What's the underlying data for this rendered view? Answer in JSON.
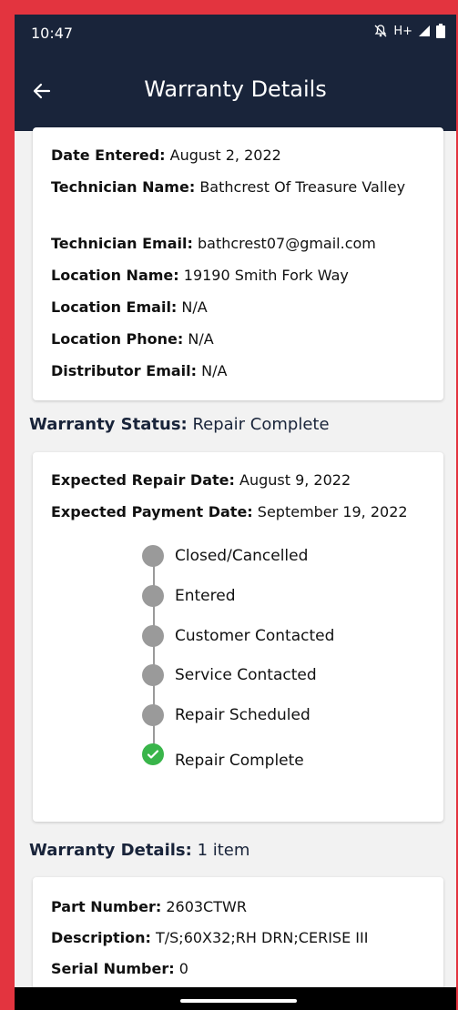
{
  "status_bar": {
    "time": "10:47",
    "network": "H+"
  },
  "app_bar": {
    "title": "Warranty Details"
  },
  "details_card": {
    "date_entered": {
      "label": "Date Entered:",
      "value": " August 2, 2022"
    },
    "technician_name": {
      "label": "Technician Name:",
      "value": " Bathcrest Of Treasure Valley"
    },
    "technician_email": {
      "label": "Technician Email:",
      "value": " bathcrest07@gmail.com"
    },
    "location_name": {
      "label": "Location Name:",
      "value": " 19190 Smith Fork Way"
    },
    "location_email": {
      "label": "Location Email:",
      "value": " N/A"
    },
    "location_phone": {
      "label": "Location Phone:",
      "value": " N/A"
    },
    "distributor_email": {
      "label": "Distributor Email:",
      "value": " N/A"
    }
  },
  "warranty_status": {
    "label": "Warranty Status:",
    "value": " Repair Complete"
  },
  "status_card": {
    "expected_repair": {
      "label": "Expected Repair Date:",
      "value": " August 9, 2022"
    },
    "expected_payment": {
      "label": "Expected Payment Date:",
      "value": " September 19, 2022"
    },
    "timeline": [
      {
        "label": "Closed/Cancelled",
        "done": false
      },
      {
        "label": "Entered",
        "done": false
      },
      {
        "label": "Customer Contacted",
        "done": false
      },
      {
        "label": "Service Contacted",
        "done": false
      },
      {
        "label": "Repair Scheduled",
        "done": false
      },
      {
        "label": "Repair Complete",
        "done": true
      }
    ]
  },
  "warranty_details": {
    "label": "Warranty Details:",
    "value": " 1 item"
  },
  "item_card": {
    "part_number": {
      "label": "Part Number:",
      "value": " 2603CTWR"
    },
    "description": {
      "label": "Description:",
      "value": " T/S;60X32;RH DRN;CERISE III"
    },
    "serial_number": {
      "label": "Serial Number:",
      "value": " 0"
    }
  },
  "colors": {
    "primary": "#19243a",
    "success": "#39b54a",
    "inactive": "#9a9a9a",
    "frame": "#e3343f"
  }
}
